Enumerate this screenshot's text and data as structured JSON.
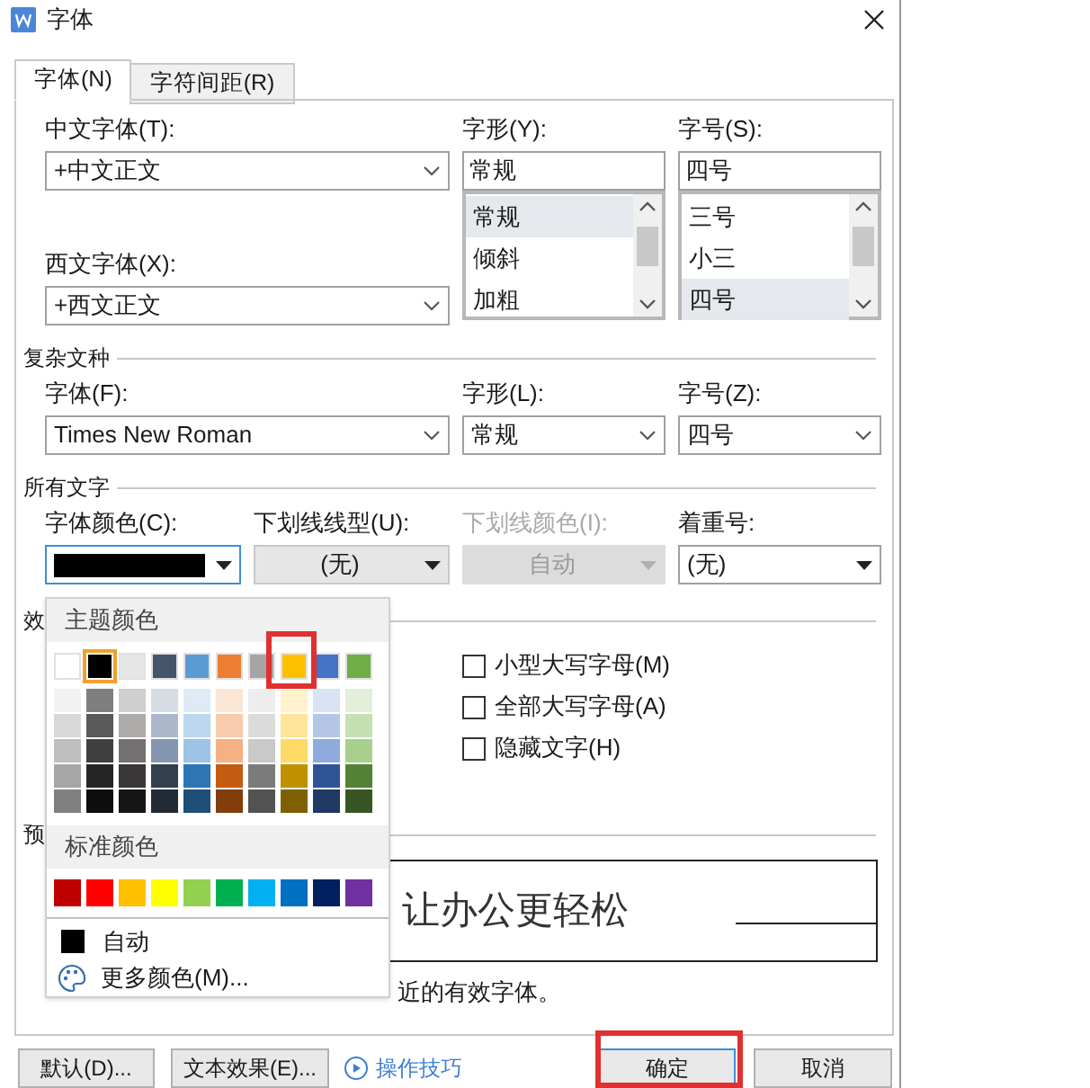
{
  "window": {
    "title": "字体"
  },
  "tabs": [
    {
      "label": "字体(N)",
      "selected": true
    },
    {
      "label": "字符间距(R)",
      "selected": false
    }
  ],
  "chinese_font": {
    "label": "中文字体(T):",
    "value": "+中文正文"
  },
  "style": {
    "label": "字形(Y):",
    "value": "常规",
    "options": [
      {
        "label": "常规",
        "selected": true
      },
      {
        "label": "倾斜",
        "selected": false
      },
      {
        "label": "加粗",
        "selected": false
      }
    ]
  },
  "size": {
    "label": "字号(S):",
    "value": "四号",
    "options": [
      {
        "label": "三号",
        "selected": false
      },
      {
        "label": "小三",
        "selected": false
      },
      {
        "label": "四号",
        "selected": true
      }
    ]
  },
  "western_font": {
    "label": "西文字体(X):",
    "value": "+西文正文"
  },
  "complex_script": {
    "title": "复杂文种",
    "fields": [
      {
        "label": "字体(F):",
        "value": "Times New Roman"
      },
      {
        "label": "字形(L):",
        "value": "常规"
      },
      {
        "label": "字号(Z):",
        "value": "四号"
      }
    ]
  },
  "all_text": {
    "title": "所有文字",
    "font_color": {
      "label": "字体颜色(C):",
      "color": "#000000"
    },
    "fields": [
      {
        "label": "下划线线型(U):",
        "value": "(无)",
        "disabled": false
      },
      {
        "label": "下划线颜色(I):",
        "value": "自动",
        "disabled": true
      },
      {
        "label": "着重号:",
        "value": "(无)",
        "disabled": false
      }
    ]
  },
  "effects": {
    "title": "效",
    "checkboxes": [
      {
        "label": "小型大写字母(M)",
        "checked": false
      },
      {
        "label": "全部大写字母(A)",
        "checked": false
      },
      {
        "label": "隐藏文字(H)",
        "checked": false
      }
    ]
  },
  "preview": {
    "title": "预",
    "sample": "让办公更轻松",
    "note": "近的有效字体。"
  },
  "buttons": [
    {
      "label": "默认(D)...",
      "kind": "button"
    },
    {
      "label": "文本效果(E)...",
      "kind": "button"
    },
    {
      "label": "操作技巧",
      "kind": "link"
    },
    {
      "label": "确定",
      "kind": "primary"
    },
    {
      "label": "取消",
      "kind": "button"
    }
  ],
  "color_menu": {
    "theme_title": "主题颜色",
    "theme_colors": [
      {
        "color": "#ffffff",
        "selected": false,
        "shades": [
          {
            "color": "#f2f2f2"
          },
          {
            "color": "#d9d9d9"
          },
          {
            "color": "#bfbfbf"
          },
          {
            "color": "#a6a6a6"
          },
          {
            "color": "#808080"
          }
        ]
      },
      {
        "color": "#000000",
        "selected": true,
        "shades": [
          {
            "color": "#7f7f7f"
          },
          {
            "color": "#595959"
          },
          {
            "color": "#404040"
          },
          {
            "color": "#262626"
          },
          {
            "color": "#0d0d0d"
          }
        ]
      },
      {
        "color": "#e7e6e6",
        "selected": false,
        "shades": [
          {
            "color": "#d0cece"
          },
          {
            "color": "#aeabab"
          },
          {
            "color": "#757171"
          },
          {
            "color": "#3a3838"
          },
          {
            "color": "#171616"
          }
        ]
      },
      {
        "color": "#44546a",
        "selected": false,
        "shades": [
          {
            "color": "#d6dce4"
          },
          {
            "color": "#adb9ca"
          },
          {
            "color": "#8496b0"
          },
          {
            "color": "#333f4f"
          },
          {
            "color": "#222a35"
          }
        ]
      },
      {
        "color": "#5b9bd5",
        "selected": false,
        "shades": [
          {
            "color": "#deebf6"
          },
          {
            "color": "#bdd7ee"
          },
          {
            "color": "#9dc3e6"
          },
          {
            "color": "#2e75b5"
          },
          {
            "color": "#1f4e79"
          }
        ]
      },
      {
        "color": "#ed7d31",
        "selected": false,
        "shades": [
          {
            "color": "#fbe5d5"
          },
          {
            "color": "#f7cbac"
          },
          {
            "color": "#f4b183"
          },
          {
            "color": "#c55a11"
          },
          {
            "color": "#833c0b"
          }
        ]
      },
      {
        "color": "#a5a5a5",
        "selected": false,
        "shades": [
          {
            "color": "#ededed"
          },
          {
            "color": "#dbdbdb"
          },
          {
            "color": "#c9c9c9"
          },
          {
            "color": "#7b7b7b"
          },
          {
            "color": "#525252"
          }
        ]
      },
      {
        "color": "#ffc000",
        "selected": false,
        "shades": [
          {
            "color": "#fff2cc"
          },
          {
            "color": "#fee599"
          },
          {
            "color": "#ffd965"
          },
          {
            "color": "#bf9000"
          },
          {
            "color": "#7f6000"
          }
        ]
      },
      {
        "color": "#4472c4",
        "selected": false,
        "shades": [
          {
            "color": "#dae3f3"
          },
          {
            "color": "#b4c7e7"
          },
          {
            "color": "#8faadc"
          },
          {
            "color": "#2f5496"
          },
          {
            "color": "#1f3864"
          }
        ]
      },
      {
        "color": "#70ad47",
        "selected": false,
        "shades": [
          {
            "color": "#e2efd9"
          },
          {
            "color": "#c5e0b3"
          },
          {
            "color": "#a8d08d"
          },
          {
            "color": "#538135"
          },
          {
            "color": "#375623"
          }
        ]
      }
    ],
    "standard_title": "标准颜色",
    "standard_colors": [
      {
        "color": "#c00000"
      },
      {
        "color": "#ff0000"
      },
      {
        "color": "#ffc000"
      },
      {
        "color": "#ffff00"
      },
      {
        "color": "#92d050"
      },
      {
        "color": "#00b050"
      },
      {
        "color": "#00b0f0"
      },
      {
        "color": "#0070c0"
      },
      {
        "color": "#002060"
      },
      {
        "color": "#7030a0"
      }
    ],
    "auto_label": "自动",
    "more_label": "更多颜色(M)..."
  }
}
